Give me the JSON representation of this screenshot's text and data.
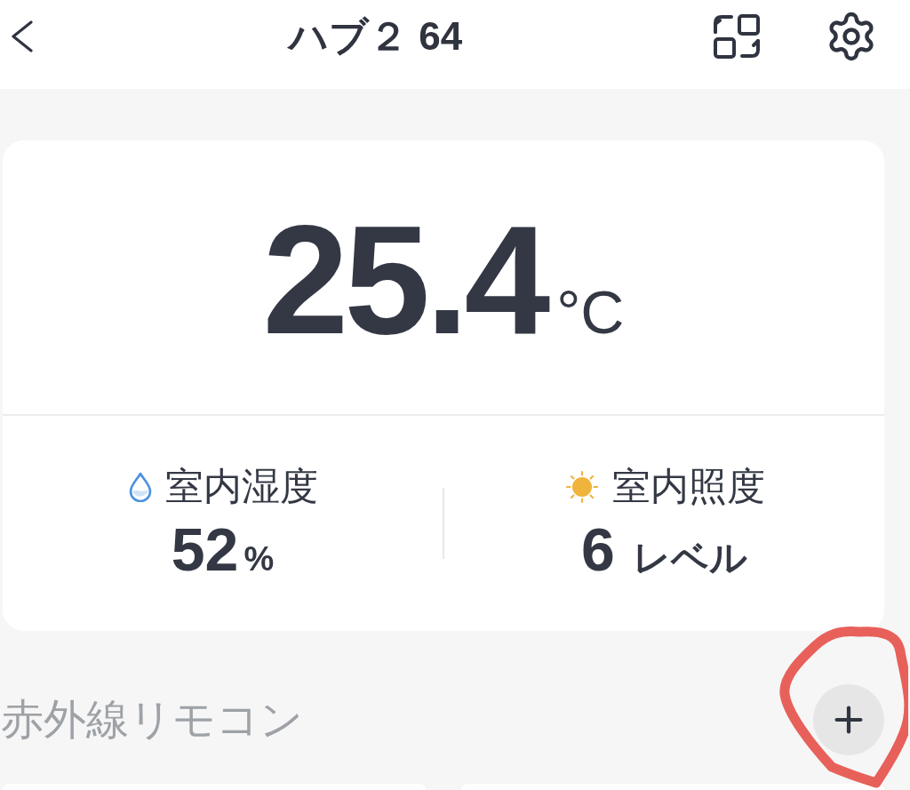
{
  "header": {
    "title": "ハブ２ 64"
  },
  "climate_card": {
    "temperature": {
      "value": "25.4",
      "unit": "°C"
    },
    "readings": [
      {
        "kind": "humidity",
        "label": "室内湿度",
        "value": "52",
        "unit": "%"
      },
      {
        "kind": "light",
        "label": "室内照度",
        "value": "6",
        "unit": "レベル"
      }
    ]
  },
  "infrared_remotes": {
    "title": "赤外線リモコン"
  }
}
